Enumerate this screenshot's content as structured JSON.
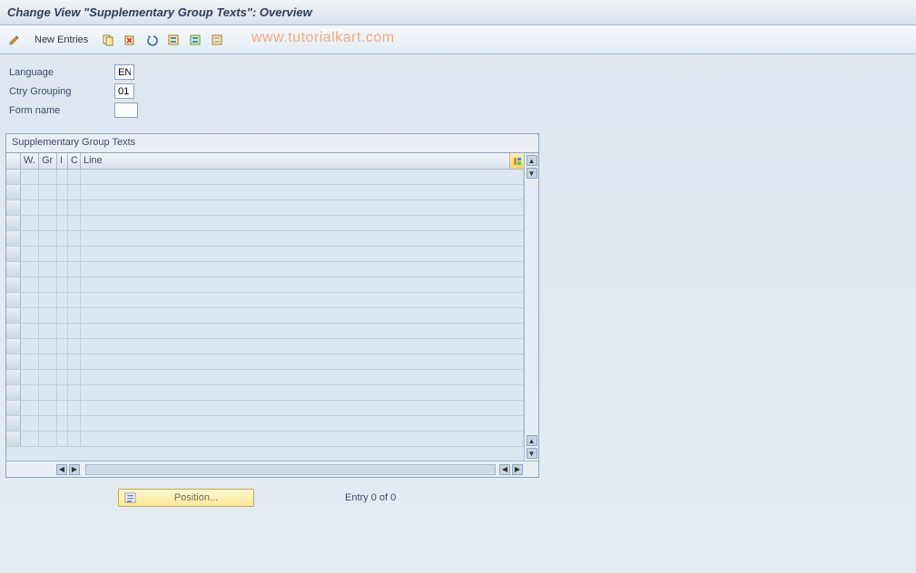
{
  "title": "Change View \"Supplementary Group Texts\": Overview",
  "toolbar": {
    "new_entries_label": "New Entries"
  },
  "watermark": "www.tutorialkart.com",
  "form": {
    "language_label": "Language",
    "language_value": "EN",
    "ctry_grouping_label": "Ctry Grouping",
    "ctry_grouping_value": "01",
    "form_name_label": "Form name",
    "form_name_value": ""
  },
  "table": {
    "title": "Supplementary Group Texts",
    "columns": {
      "w": "W.",
      "gr": "Gr",
      "i": "I",
      "c": "C",
      "line": "Line"
    },
    "row_count": 18
  },
  "footer": {
    "position_label": "Position...",
    "entry_text": "Entry 0 of 0"
  },
  "colors": {
    "accent_orange": "#f29a6c",
    "sap_gold": "#ffe89a"
  }
}
